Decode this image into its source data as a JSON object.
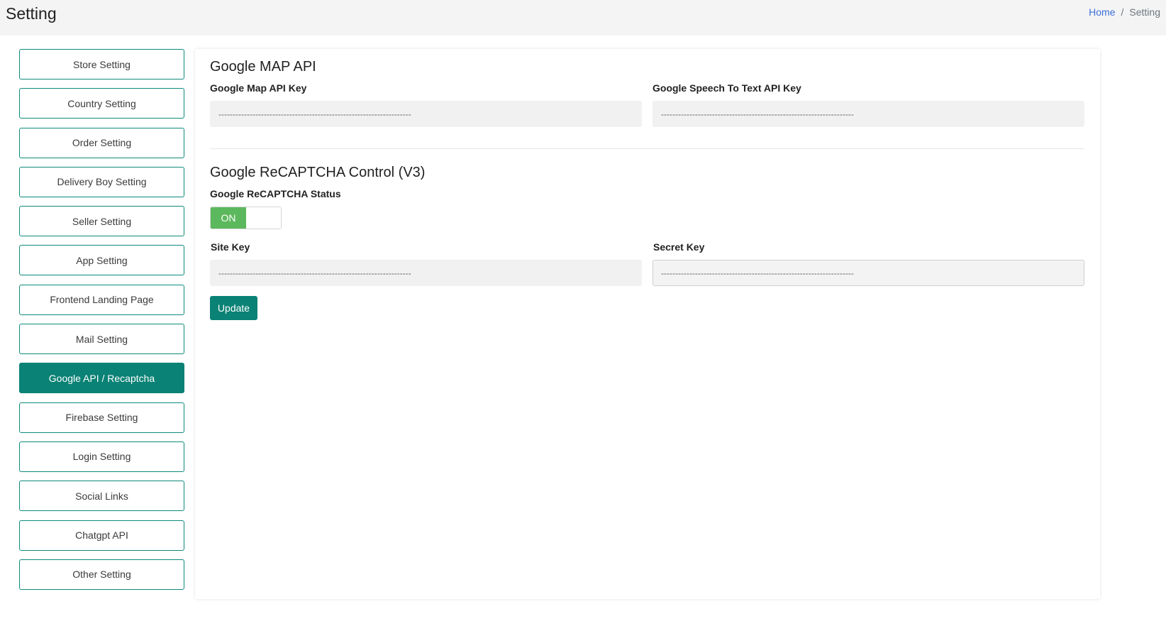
{
  "header": {
    "title": "Setting",
    "breadcrumb": {
      "home": "Home",
      "separator": "/",
      "current": "Setting"
    }
  },
  "sidebar": {
    "items": [
      {
        "label": "Store Setting",
        "active": false
      },
      {
        "label": "Country Setting",
        "active": false
      },
      {
        "label": "Order Setting",
        "active": false
      },
      {
        "label": "Delivery Boy Setting",
        "active": false
      },
      {
        "label": "Seller Setting",
        "active": false
      },
      {
        "label": "App Setting",
        "active": false
      },
      {
        "label": "Frontend Landing Page",
        "active": false
      },
      {
        "label": "Mail Setting",
        "active": false
      },
      {
        "label": "Google API / Recaptcha",
        "active": true
      },
      {
        "label": "Firebase Setting",
        "active": false
      },
      {
        "label": "Login Setting",
        "active": false
      },
      {
        "label": "Social Links",
        "active": false
      },
      {
        "label": "Chatgpt API",
        "active": false
      },
      {
        "label": "Other Setting",
        "active": false
      }
    ]
  },
  "map_section": {
    "title": "Google MAP API",
    "map_key_label": "Google Map API Key",
    "map_key_value": "--------------------------------------------------------------------",
    "speech_key_label": "Google Speech To Text API Key",
    "speech_key_value": "--------------------------------------------------------------------"
  },
  "recaptcha_section": {
    "title": "Google ReCAPTCHA Control (V3)",
    "status_label": "Google ReCAPTCHA Status",
    "status_toggle": "ON",
    "site_key_label": "Site Key",
    "site_key_value": "--------------------------------------------------------------------",
    "secret_key_label": "Secret Key",
    "secret_key_value": "--------------------------------------------------------------------"
  },
  "actions": {
    "update_label": "Update"
  },
  "colors": {
    "accent": "#0a8275",
    "toggle_on": "#5cb85c",
    "link": "#3b6fd8"
  }
}
